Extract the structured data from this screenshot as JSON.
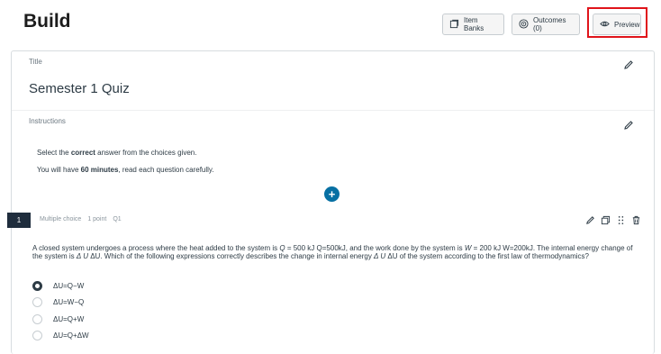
{
  "page": {
    "title": "Build"
  },
  "toolbar": {
    "item_banks_label": "Item Banks",
    "outcomes_label": "Outcomes (0)",
    "preview_label": "Preview"
  },
  "quiz": {
    "title_label": "Title",
    "title": "Semester 1 Quiz",
    "instructions_label": "Instructions",
    "instructions": {
      "line1_pre": "Select the ",
      "line1_bold": "correct",
      "line1_post": " answer from the choices given.",
      "line2_pre": "You will have ",
      "line2_bold": "60 minutes",
      "line2_post": ", read each question carefully."
    }
  },
  "add_button": {
    "label": "+"
  },
  "question": {
    "number": "1",
    "type": "Multiple choice",
    "points": "1 point",
    "id": "Q1",
    "text_part1": "A closed system undergoes a process where the heat added to the system is ",
    "math_q": "Q",
    "text_part2": " = 500  kJ Q=500kJ, and the work done by the system is ",
    "math_w": "W",
    "text_part3": " = 200  kJ W=200kJ. The internal energy change of the system is ",
    "math_du1": "Δ U",
    "text_part4": " ΔU. Which of the following expressions correctly describes the change in internal energy ",
    "math_du2": "Δ U",
    "text_part5": " ΔU of the system according to the first law of thermodynamics?",
    "choices": [
      {
        "label": "ΔU=Q−W",
        "selected": true
      },
      {
        "label": "ΔU=W−Q",
        "selected": false
      },
      {
        "label": "ΔU=Q+W",
        "selected": false
      },
      {
        "label": "ΔU=Q+ΔW",
        "selected": false
      }
    ]
  },
  "colors": {
    "highlight": "#e0141b",
    "accent": "#0770a3",
    "dark": "#1f2d3d"
  }
}
